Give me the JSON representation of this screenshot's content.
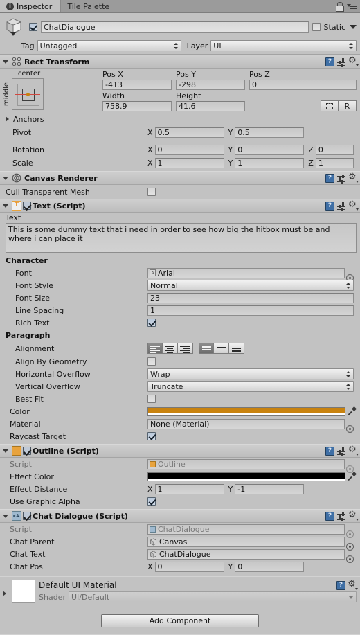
{
  "window": {
    "tabs": [
      {
        "label": "Inspector",
        "icon": "info-icon",
        "active": true
      },
      {
        "label": "Tile Palette",
        "icon": "",
        "active": false
      }
    ],
    "lock_icon": "lock-icon",
    "menu_icon": "hamburger-menu-icon"
  },
  "gameobject": {
    "icon": "cube-icon",
    "enabled": true,
    "name": "ChatDialogue",
    "static_label": "Static",
    "static_checked": false,
    "tag_label": "Tag",
    "tag_value": "Untagged",
    "layer_label": "Layer",
    "layer_value": "UI"
  },
  "rect_transform": {
    "title": "Rect Transform",
    "anchor_preset": {
      "top_label": "center",
      "side_label": "middle"
    },
    "pos_x_label": "Pos X",
    "pos_x": "-413",
    "pos_y_label": "Pos Y",
    "pos_y": "-298",
    "pos_z_label": "Pos Z",
    "pos_z": "0",
    "width_label": "Width",
    "width": "758.9",
    "height_label": "Height",
    "height": "41.6",
    "blueprint_button": "blueprint-mode-icon",
    "raw_button": "R",
    "anchors_label": "Anchors",
    "pivot_label": "Pivot",
    "pivot_x": "0.5",
    "pivot_y": "0.5",
    "rotation_label": "Rotation",
    "rot_x": "0",
    "rot_y": "0",
    "rot_z": "0",
    "scale_label": "Scale",
    "scale_x": "1",
    "scale_y": "1",
    "scale_z": "1",
    "axis_x": "X",
    "axis_y": "Y",
    "axis_z": "Z"
  },
  "canvas_renderer": {
    "title": "Canvas Renderer",
    "cull_label": "Cull Transparent Mesh",
    "cull_checked": false
  },
  "text_script": {
    "title": "Text (Script)",
    "enabled": true,
    "icon": "text-component-icon",
    "text_label": "Text",
    "text_value": "This is some dummy text that i need in order to see how big the hitbox must be and where i can place it",
    "character_header": "Character",
    "font_label": "Font",
    "font_value": "Arial",
    "font_style_label": "Font Style",
    "font_style_value": "Normal",
    "font_size_label": "Font Size",
    "font_size_value": "23",
    "line_spacing_label": "Line Spacing",
    "line_spacing_value": "1",
    "rich_text_label": "Rich Text",
    "rich_text_checked": true,
    "paragraph_header": "Paragraph",
    "alignment_label": "Alignment",
    "alignment_horizontal": "left",
    "alignment_vertical": "top",
    "align_by_geometry_label": "Align By Geometry",
    "align_by_geometry_checked": false,
    "horizontal_overflow_label": "Horizontal Overflow",
    "horizontal_overflow_value": "Wrap",
    "vertical_overflow_label": "Vertical Overflow",
    "vertical_overflow_value": "Truncate",
    "best_fit_label": "Best Fit",
    "best_fit_checked": false,
    "color_label": "Color",
    "color_value": "#c8820e",
    "material_label": "Material",
    "material_value": "None (Material)",
    "raycast_target_label": "Raycast Target",
    "raycast_target_checked": true
  },
  "outline_script": {
    "title": "Outline (Script)",
    "enabled": true,
    "icon": "outline-component-icon",
    "script_label": "Script",
    "script_value": "Outline",
    "effect_color_label": "Effect Color",
    "effect_color_value": "#000000",
    "effect_distance_label": "Effect Distance",
    "effect_distance_x": "1",
    "effect_distance_y": "-1",
    "use_graphic_alpha_label": "Use Graphic Alpha",
    "use_graphic_alpha_checked": true,
    "axis_x": "X",
    "axis_y": "Y"
  },
  "chat_dialogue_script": {
    "title": "Chat Dialogue (Script)",
    "enabled": true,
    "icon": "csharp-script-icon",
    "script_label": "Script",
    "script_value": "ChatDialogue",
    "chat_parent_label": "Chat Parent",
    "chat_parent_value": "Canvas",
    "chat_text_label": "Chat Text",
    "chat_text_value": "ChatDialogue",
    "chat_pos_label": "Chat Pos",
    "chat_pos_x": "0",
    "chat_pos_y": "0",
    "axis_x": "X",
    "axis_y": "Y"
  },
  "material_preview": {
    "title": "Default UI Material",
    "shader_label": "Shader",
    "shader_value": "UI/Default"
  },
  "footer": {
    "add_component_label": "Add Component"
  }
}
